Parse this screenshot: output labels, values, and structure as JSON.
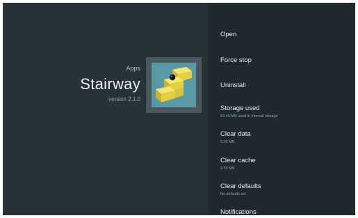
{
  "app": {
    "breadcrumb": "Apps",
    "title": "Stairway",
    "version": "version 2.1.0",
    "icon": "stairway-app-icon"
  },
  "menu": {
    "items": [
      {
        "label": "Open",
        "sub": ""
      },
      {
        "label": "Force stop",
        "sub": ""
      },
      {
        "label": "Uninstall",
        "sub": ""
      },
      {
        "label": "Storage used",
        "sub": "63.45 MB used in Internal storage"
      },
      {
        "label": "Clear data",
        "sub": "5.02 MB"
      },
      {
        "label": "Clear cache",
        "sub": "3.50 MB"
      },
      {
        "label": "Clear defaults",
        "sub": "No defaults set"
      },
      {
        "label": "Notifications",
        "sub": ""
      }
    ]
  },
  "colors": {
    "background": "#263238",
    "panel": "#1f282d",
    "icon_bg": "#5a9aa6",
    "stairs": "#e8d84a"
  }
}
